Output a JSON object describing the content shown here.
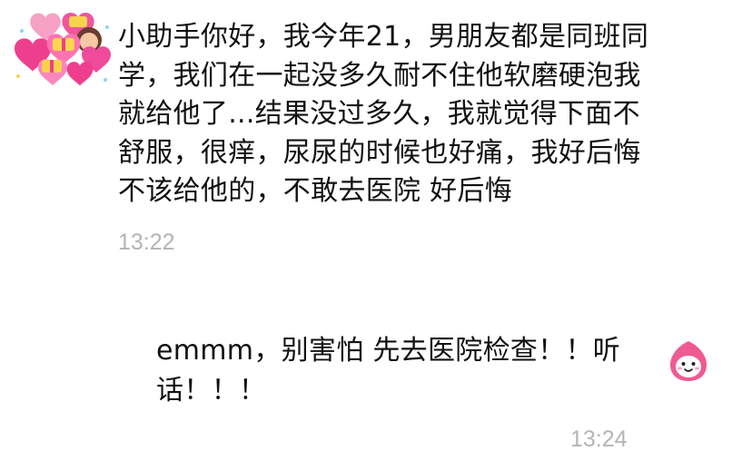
{
  "conversation": {
    "incoming": {
      "avatar_icon": "hearts-sticker-avatar-icon",
      "text": "小助手你好，我今年21，男朋友都是同班同学，我们在一起没多久耐不住他软磨硬泡我就给他了...结果没过多久，我就觉得下面不舒服，很痒，尿尿的时候也好痛，我好后悔不该给他的，不敢去医院 好后悔",
      "time": "13:22"
    },
    "outgoing": {
      "avatar_icon": "pink-cartoon-face-avatar-icon",
      "text": "emmm，别害怕 先去医院检查！！听话！！！",
      "time": "13:24"
    }
  },
  "colors": {
    "text": "#111111",
    "timestamp": "#b4b4b4",
    "heart_pink": "#f04a9a",
    "avatar_pink": "#f05a92"
  }
}
